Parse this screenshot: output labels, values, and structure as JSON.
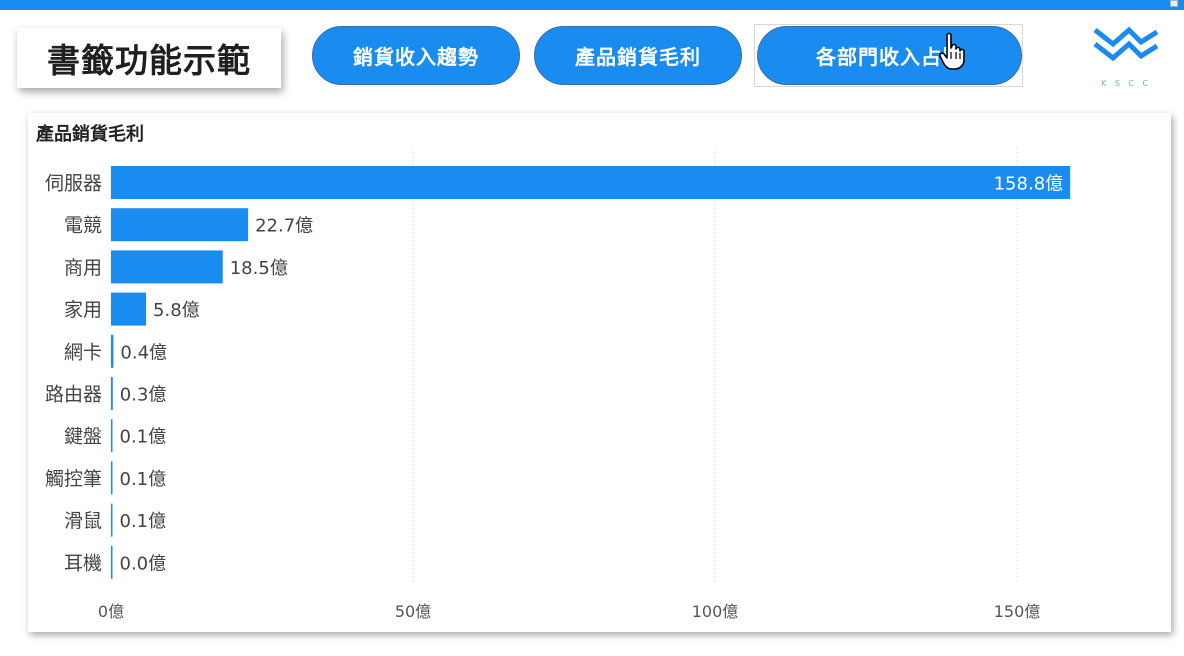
{
  "header": {
    "title": "書籤功能示範",
    "buttons": [
      {
        "label": "銷貨收入趨勢"
      },
      {
        "label": "產品銷貨毛利"
      },
      {
        "label": "各部門收入占比"
      }
    ],
    "logo_text": "K S C C"
  },
  "colors": {
    "accent": "#1a8cf0",
    "bar": "#1a8cf0"
  },
  "chart_data": {
    "type": "bar",
    "orientation": "horizontal",
    "title": "產品銷貨毛利",
    "categories": [
      "伺服器",
      "電競",
      "商用",
      "家用",
      "網卡",
      "路由器",
      "鍵盤",
      "觸控筆",
      "滑鼠",
      "耳機"
    ],
    "values": [
      158.8,
      22.7,
      18.5,
      5.8,
      0.4,
      0.3,
      0.1,
      0.1,
      0.1,
      0.0
    ],
    "value_labels": [
      "158.8億",
      "22.7億",
      "18.5億",
      "5.8億",
      "0.4億",
      "0.3億",
      "0.1億",
      "0.1億",
      "0.1億",
      "0.0億"
    ],
    "x_ticks": [
      0,
      50,
      100,
      150
    ],
    "x_tick_labels": [
      "0億",
      "50億",
      "100億",
      "150億"
    ],
    "xlim": [
      0,
      175
    ],
    "grid": true,
    "xlabel": "",
    "ylabel": ""
  }
}
